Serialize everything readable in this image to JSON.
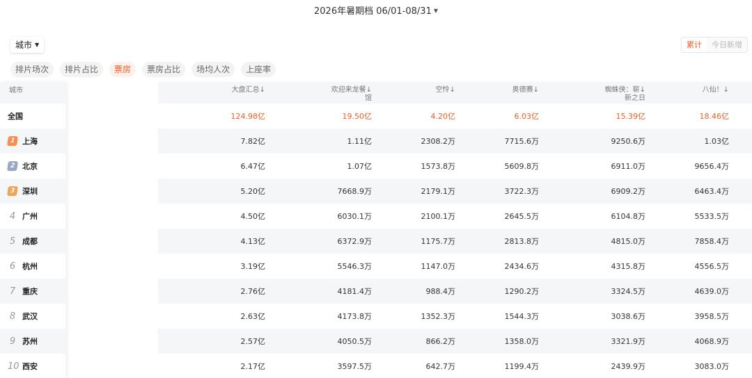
{
  "header": {
    "period": "2026年暑期档 06/01-08/31",
    "period_caret": "▼"
  },
  "filters": {
    "city_label": "城市",
    "city_caret": "▼",
    "mode_cumulative": "累计",
    "mode_daily": "今日新增"
  },
  "tabs": [
    "排片场次",
    "排片占比",
    "票房",
    "票房占比",
    "场均人次",
    "上座率"
  ],
  "active_tab": 2,
  "colors": {
    "accent": "#ff5a24",
    "rank1": "#f98d52",
    "rank2": "#9aa7c4",
    "rank3": "#f0a457"
  },
  "table": {
    "city_header": "城市",
    "columns": [
      {
        "line1": "大盘汇总↓",
        "line2": ""
      },
      {
        "line1": "欢迎来龙餐↓",
        "line2": "馆"
      },
      {
        "line1": "空怜↓",
        "line2": ""
      },
      {
        "line1": "奥德赛↓",
        "line2": ""
      },
      {
        "line1": "蜘蛛侠：崭↓",
        "line2": "新之日"
      },
      {
        "line1": "八仙！↓",
        "line2": ""
      }
    ],
    "rows": [
      {
        "rank": "",
        "city": "全国",
        "highlight": true,
        "values": [
          "124.98亿",
          "19.50亿",
          "4.20亿",
          "6.03亿",
          "15.39亿",
          "18.46亿"
        ]
      },
      {
        "rank": "1",
        "city": "上海",
        "highlight": false,
        "values": [
          "7.82亿",
          "1.11亿",
          "2308.2万",
          "7715.6万",
          "9250.6万",
          "1.03亿"
        ]
      },
      {
        "rank": "2",
        "city": "北京",
        "highlight": false,
        "values": [
          "6.47亿",
          "1.07亿",
          "1573.8万",
          "5609.8万",
          "6911.0万",
          "9656.4万"
        ]
      },
      {
        "rank": "3",
        "city": "深圳",
        "highlight": false,
        "values": [
          "5.20亿",
          "7668.9万",
          "2179.1万",
          "3722.3万",
          "6909.2万",
          "6463.4万"
        ]
      },
      {
        "rank": "4",
        "city": "广州",
        "highlight": false,
        "values": [
          "4.50亿",
          "6030.1万",
          "2100.1万",
          "2645.5万",
          "6104.8万",
          "5533.5万"
        ]
      },
      {
        "rank": "5",
        "city": "成都",
        "highlight": false,
        "values": [
          "4.13亿",
          "6372.9万",
          "1175.7万",
          "2813.8万",
          "4815.0万",
          "7858.4万"
        ]
      },
      {
        "rank": "6",
        "city": "杭州",
        "highlight": false,
        "values": [
          "3.19亿",
          "5546.3万",
          "1147.0万",
          "2434.6万",
          "4315.8万",
          "4556.5万"
        ]
      },
      {
        "rank": "7",
        "city": "重庆",
        "highlight": false,
        "values": [
          "2.76亿",
          "4181.4万",
          "988.4万",
          "1290.2万",
          "3324.5万",
          "4639.0万"
        ]
      },
      {
        "rank": "8",
        "city": "武汉",
        "highlight": false,
        "values": [
          "2.63亿",
          "4173.8万",
          "1352.3万",
          "1544.3万",
          "3038.6万",
          "3958.5万"
        ]
      },
      {
        "rank": "9",
        "city": "苏州",
        "highlight": false,
        "values": [
          "2.57亿",
          "4050.5万",
          "866.2万",
          "1358.0万",
          "3321.9万",
          "4068.9万"
        ]
      },
      {
        "rank": "10",
        "city": "西安",
        "highlight": false,
        "values": [
          "2.17亿",
          "3597.5万",
          "642.7万",
          "1199.4万",
          "2439.9万",
          "3083.0万"
        ]
      }
    ]
  }
}
